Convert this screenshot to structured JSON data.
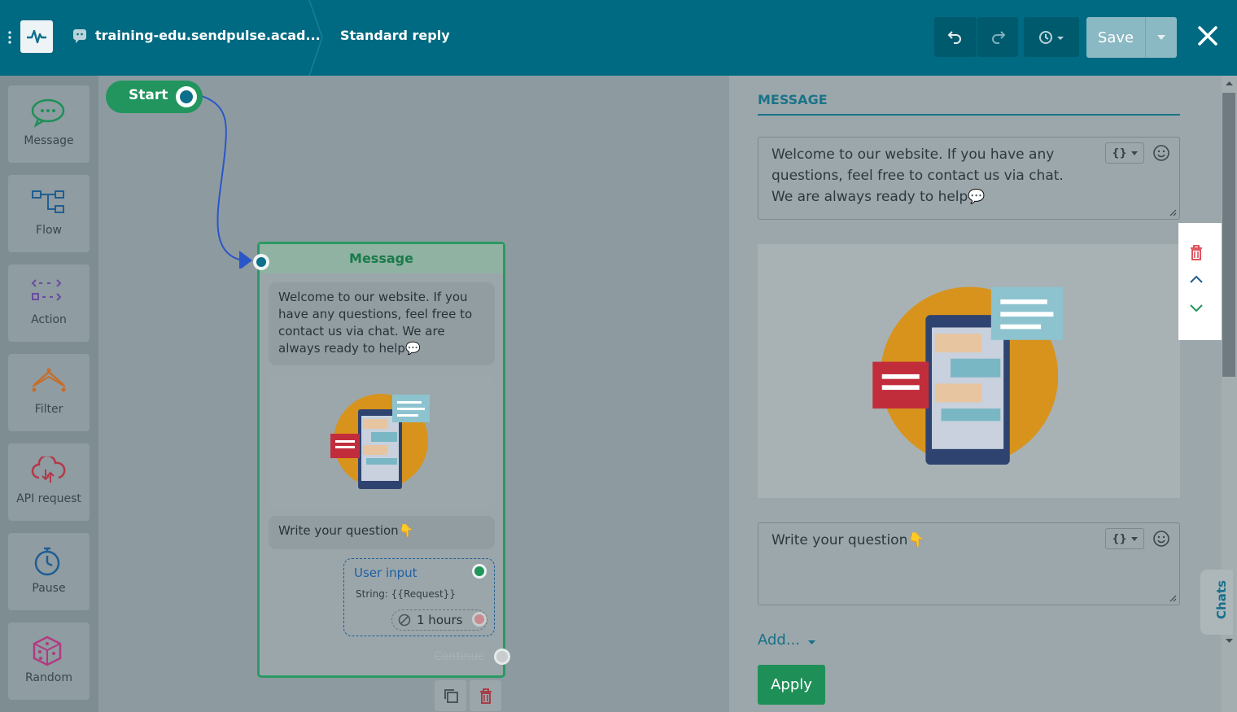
{
  "header": {
    "breadcrumb_bot": "training-edu.sendpulse.acad...",
    "breadcrumb_flow": "Standard reply",
    "save_label": "Save"
  },
  "sidebar": {
    "items": [
      {
        "label": "Message",
        "icon": "chat-bubble-icon"
      },
      {
        "label": "Flow",
        "icon": "flow-icon"
      },
      {
        "label": "Action",
        "icon": "action-icon"
      },
      {
        "label": "Filter",
        "icon": "filter-icon"
      },
      {
        "label": "API request",
        "icon": "cloud-api-icon"
      },
      {
        "label": "Pause",
        "icon": "stopwatch-icon"
      },
      {
        "label": "Random",
        "icon": "dice-icon"
      }
    ]
  },
  "canvas": {
    "start_label": "Start",
    "node": {
      "title": "Message",
      "text": "Welcome to our website. If you have any questions, feel free to contact us via chat. We are always ready to help💬",
      "question": "Write your question👇",
      "user_input": {
        "title": "User input",
        "string": "String: {{Request}}",
        "timeout": "1 hours"
      },
      "continue_label": "Continue"
    }
  },
  "panel": {
    "section_title": "MESSAGE",
    "text_block_1": "Welcome to our website. If you have any questions, feel free to contact us via chat. We are always ready to help💬",
    "text_block_2": "Write your question👇",
    "add_label": "Add...",
    "apply_label": "Apply"
  },
  "chats_tab": "Chats",
  "colors": {
    "header_bg": "#006a82",
    "accent_green": "#21955d",
    "accent_blue": "#1a7388"
  }
}
